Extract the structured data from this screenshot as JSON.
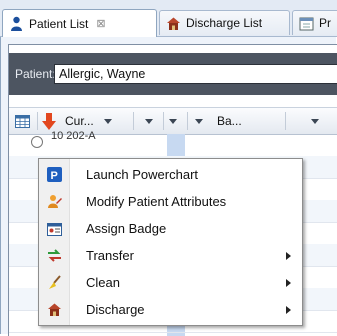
{
  "tabs": [
    {
      "label": "Patient List",
      "close": "⊠",
      "icon": "person-icon"
    },
    {
      "label": "Discharge List",
      "icon": "house-icon"
    },
    {
      "label": "Pr",
      "icon": "calendar-icon"
    }
  ],
  "patient": {
    "label": "Patient:",
    "value": "Allergic, Wayne"
  },
  "columns": [
    {
      "icon": "grid-icon"
    },
    {
      "icon": "down-arrow-icon",
      "label": "Cur..."
    },
    {
      "label": ""
    },
    {
      "label": ""
    },
    {
      "label": "Ba..."
    },
    {
      "label": ""
    }
  ],
  "row_partial": "10 202-A",
  "menu": {
    "items": [
      {
        "label": "Launch Powerchart",
        "icon": "powerchart-icon",
        "submenu": false
      },
      {
        "label": "Modify Patient Attributes",
        "icon": "user-edit-icon",
        "submenu": false
      },
      {
        "label": "Assign Badge",
        "icon": "badge-icon",
        "submenu": false
      },
      {
        "label": "Transfer",
        "icon": "transfer-icon",
        "submenu": true
      },
      {
        "label": "Clean",
        "icon": "broom-icon",
        "submenu": true
      },
      {
        "label": "Discharge",
        "icon": "house-icon",
        "submenu": true
      }
    ]
  },
  "colors": {
    "accent": "#1f5fbf",
    "patient_bar": "#4d5561",
    "selection": "#c7d9f1"
  }
}
